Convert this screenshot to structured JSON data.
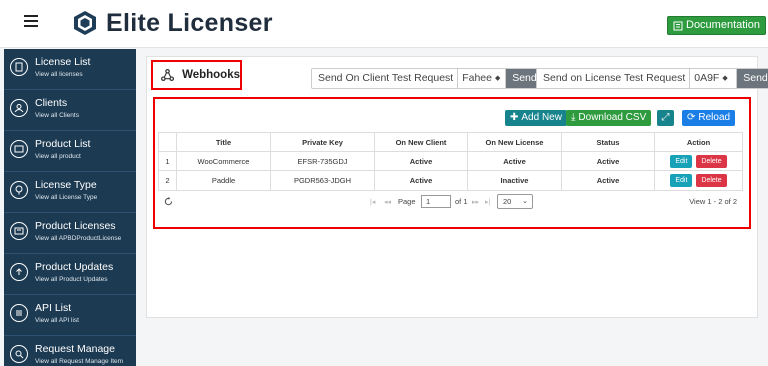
{
  "header": {
    "app_title": "Elite Licenser",
    "doc_button": "Documentation",
    "accent": "#2e9b3f"
  },
  "sidebar": {
    "bg": "#1c3a52",
    "items": [
      {
        "label": "License List",
        "sub": "View all licenses",
        "icon": "license-icon"
      },
      {
        "label": "Clients",
        "sub": "View all Clients",
        "icon": "clients-icon"
      },
      {
        "label": "Product List",
        "sub": "View all product",
        "icon": "product-icon"
      },
      {
        "label": "License Type",
        "sub": "View all License Type",
        "icon": "license-type-icon"
      },
      {
        "label": "Product Licenses",
        "sub": "View all APBDProductLicense",
        "icon": "product-license-icon"
      },
      {
        "label": "Product Updates",
        "sub": "View all Product Updates",
        "icon": "upload-icon"
      },
      {
        "label": "API List",
        "sub": "View all API list",
        "icon": "api-icon"
      },
      {
        "label": "Request Manage",
        "sub": "View all Request Manage Item",
        "icon": "request-icon"
      }
    ]
  },
  "webhooks": {
    "title": "Webhooks"
  },
  "client_test": {
    "label": "Send On Client Test Request",
    "selected": "Fahee",
    "send": "Send"
  },
  "license_test": {
    "label": "Send on License Test Request",
    "selected": "0A9F",
    "send": "Send"
  },
  "toolbar": {
    "add_new": "Add New",
    "download_csv": "Download CSV",
    "reload": "Reload"
  },
  "grid": {
    "columns": [
      "Title",
      "Private Key",
      "On New Client",
      "On New License",
      "Status",
      "Action"
    ],
    "rows": [
      {
        "num": "1",
        "title": "WooCommerce",
        "key": "EFSR-735GDJ",
        "client": "Active",
        "license": "Active",
        "status": "Active"
      },
      {
        "num": "2",
        "title": "Paddle",
        "key": "PGDR563-JDGH",
        "client": "Active",
        "license": "Inactive",
        "status": "Active"
      }
    ],
    "edit": "Edit",
    "delete": "Delete"
  },
  "pager": {
    "page_label": "Page",
    "page_value": "1",
    "of_label": "of 1",
    "page_size": "20",
    "view_text": "View 1 - 2 of 2"
  }
}
